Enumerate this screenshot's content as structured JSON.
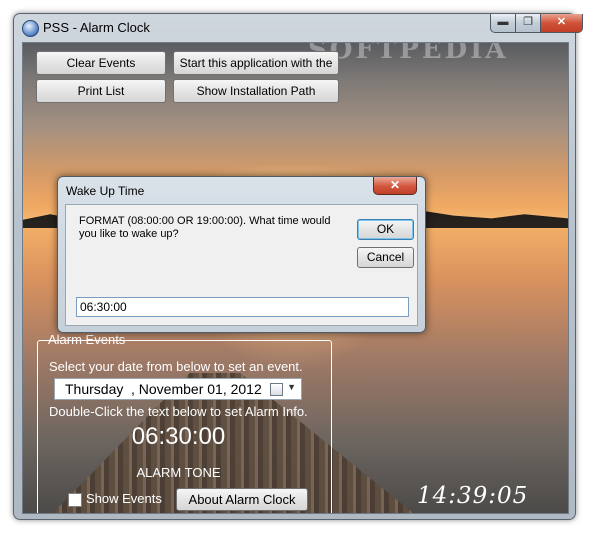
{
  "window": {
    "title": "PSS - Alarm Clock",
    "watermark": "SOFTPEDIA",
    "caption_buttons": {
      "minimize": "▬",
      "maximize": "❐",
      "close": "✕"
    }
  },
  "toolbar": {
    "clear_events": "Clear Events",
    "start_with_pc": "Start this application with the PC",
    "print_list": "Print List",
    "show_install_path": "Show Installation Path"
  },
  "alarm_events": {
    "group_title": "Alarm Events",
    "select_date_text": "Select your date from below to set an event.",
    "date_day": "Thursday",
    "date_rest": ", November 01, 2012",
    "double_click_text": "Double-Click the text below to set Alarm Info.",
    "alarm_time": "06:30:00",
    "alarm_tone": "ALARM TONE",
    "show_events_label": "Show Events",
    "show_events_checked": false,
    "about_button": "About Alarm Clock"
  },
  "clock": {
    "time": "14:39:05"
  },
  "dialog": {
    "title": "Wake Up Time",
    "close": "✕",
    "prompt": "FORMAT (08:00:00  OR   19:00:00). What time would you like to wake up?",
    "ok": "OK",
    "cancel": "Cancel",
    "input_value": "06:30:00"
  }
}
